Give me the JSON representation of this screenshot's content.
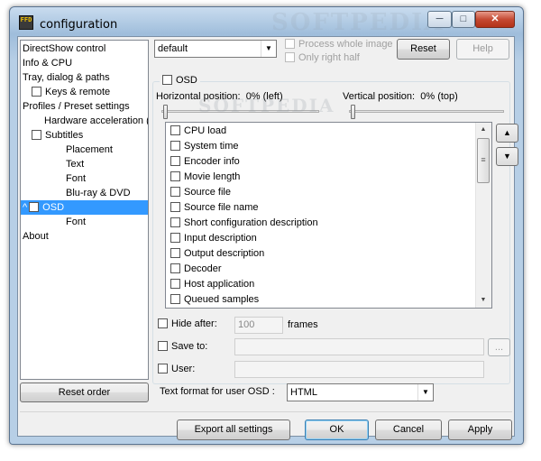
{
  "window": {
    "title": "configuration",
    "app_icon_text": "FFD",
    "controls": {
      "minimize": "─",
      "maximize": "□",
      "close": "✕"
    }
  },
  "tree": {
    "items": [
      {
        "label": "DirectShow control"
      },
      {
        "label": "Info & CPU"
      },
      {
        "label": "Tray, dialog & paths"
      },
      {
        "label": "Keys & remote",
        "checkbox": true
      },
      {
        "label": "Profiles / Preset settings"
      },
      {
        "label": "Hardware acceleration ("
      },
      {
        "label": "Subtitles",
        "checkbox": true
      },
      {
        "label": "Placement"
      },
      {
        "label": "Text"
      },
      {
        "label": "Font"
      },
      {
        "label": "Blu-ray & DVD"
      },
      {
        "label": "OSD",
        "checkbox": true,
        "selected": true,
        "expander": "^"
      },
      {
        "label": "Font"
      },
      {
        "label": "About"
      }
    ],
    "reset_order": "Reset order"
  },
  "top": {
    "preset": "default",
    "process_whole_image": "Process whole image",
    "only_right_half": "Only right half",
    "reset": "Reset",
    "help": "Help"
  },
  "osd": {
    "group_label": "OSD",
    "horizontal_label": "Horizontal position:",
    "horizontal_value": "0% (left)",
    "horizontal_percent": 0,
    "vertical_label": "Vertical position:",
    "vertical_value": "0% (top)",
    "vertical_percent": 0,
    "list_items": [
      "CPU load",
      "System time",
      "Encoder info",
      "Movie length",
      "Source file",
      "Source file name",
      "Short configuration description",
      "Input description",
      "Output description",
      "Decoder",
      "Host application",
      "Queued samples"
    ],
    "move_up": "▲",
    "move_down": "▼",
    "hide_after_label": "Hide after:",
    "hide_after_value": "100",
    "frames_label": "frames",
    "save_to_label": "Save to:",
    "save_to_value": "",
    "browse": "...",
    "user_label": "User:",
    "user_value": "",
    "text_format_label": "Text format for user OSD :",
    "text_format_value": "HTML"
  },
  "bottom": {
    "export": "Export all settings",
    "ok": "OK",
    "cancel": "Cancel",
    "apply": "Apply"
  },
  "watermark": "SOFTPEDIA"
}
